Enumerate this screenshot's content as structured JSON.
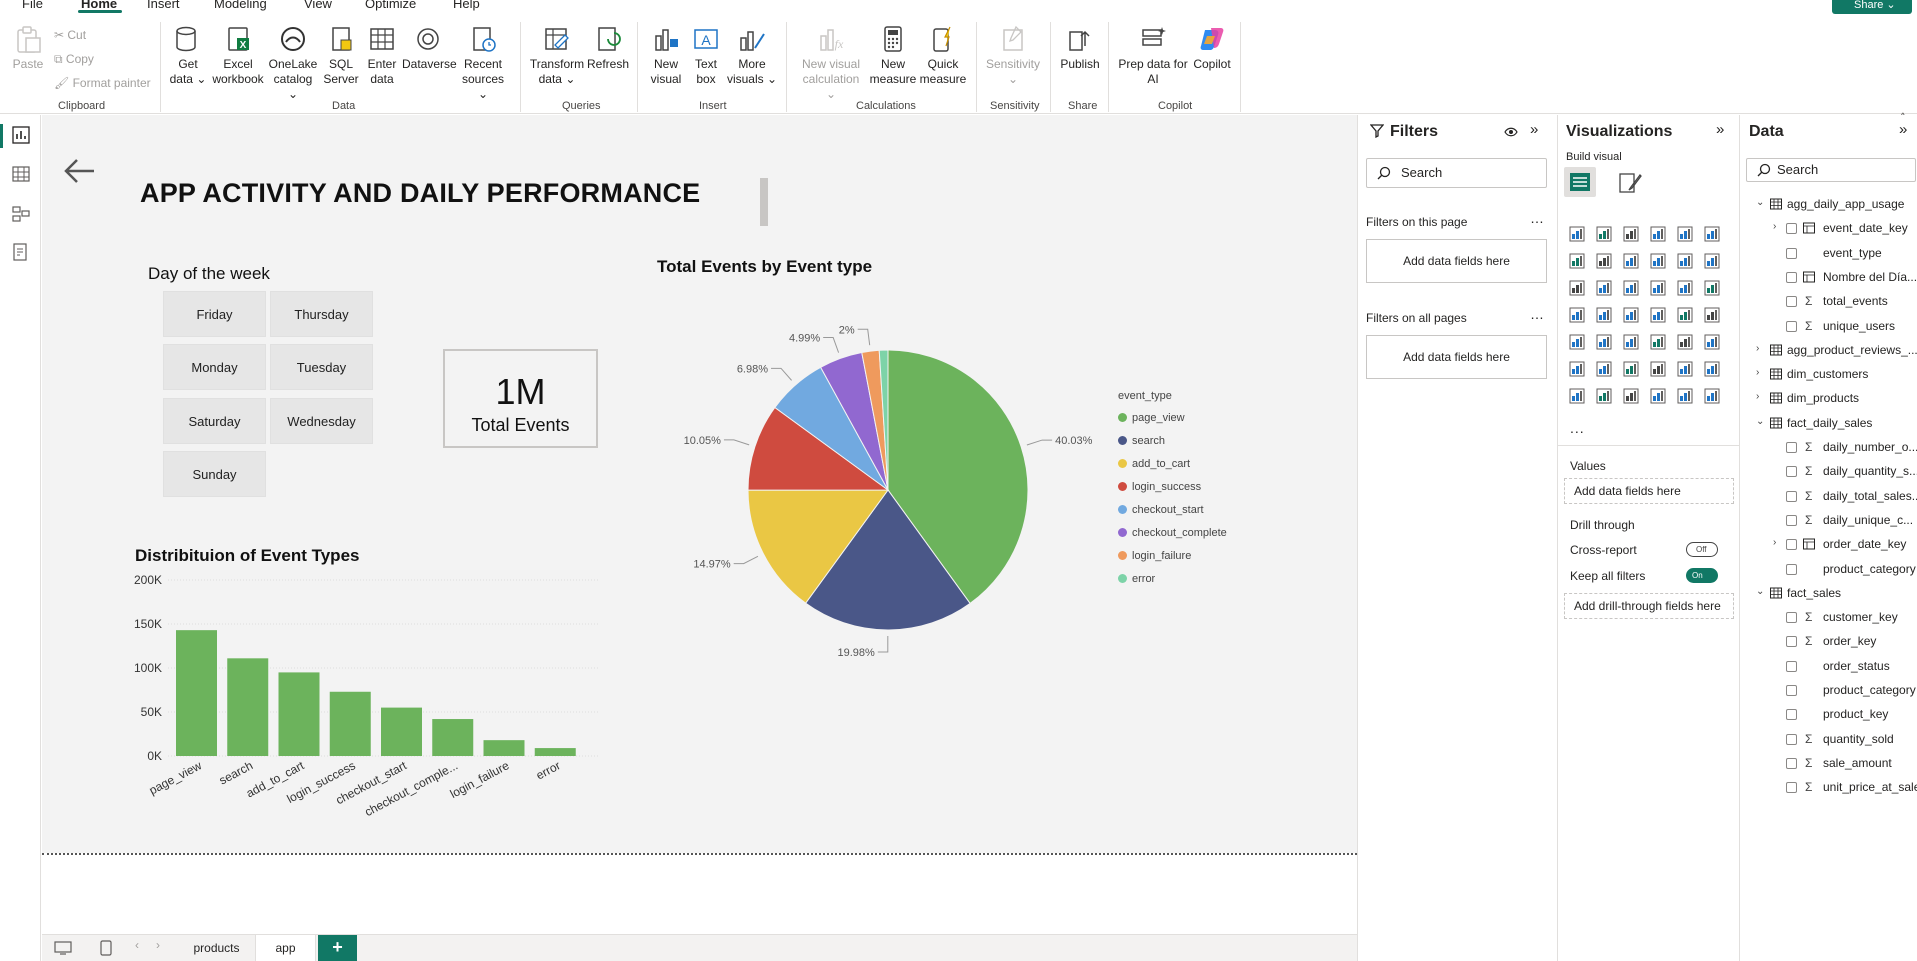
{
  "menu": {
    "items": [
      "File",
      "Home",
      "Insert",
      "Modeling",
      "View",
      "Optimize",
      "Help"
    ],
    "active": "Home",
    "share_label": "Share"
  },
  "ribbon": {
    "clipboard": {
      "paste": "Paste",
      "cut": "Cut",
      "copy": "Copy",
      "format_painter": "Format painter",
      "group": "Clipboard"
    },
    "data": {
      "get_data": [
        "Get",
        "data"
      ],
      "excel": [
        "Excel",
        "workbook"
      ],
      "onelake": [
        "OneLake",
        "catalog"
      ],
      "sql": [
        "SQL",
        "Server"
      ],
      "enter": [
        "Enter",
        "data"
      ],
      "dataverse": [
        "Dataverse"
      ],
      "recent": [
        "Recent",
        "sources"
      ],
      "group": "Data"
    },
    "queries": {
      "transform": [
        "Transform",
        "data"
      ],
      "refresh": [
        "Refresh"
      ],
      "group": "Queries"
    },
    "insert": {
      "new_visual": [
        "New",
        "visual"
      ],
      "text_box": [
        "Text",
        "box"
      ],
      "more_visuals": [
        "More",
        "visuals"
      ],
      "group": "Insert"
    },
    "calculations": {
      "new_visual_calc": [
        "New visual",
        "calculation"
      ],
      "new_measure": [
        "New",
        "measure"
      ],
      "quick_measure": [
        "Quick",
        "measure"
      ],
      "group": "Calculations"
    },
    "sensitivity": {
      "label": "Sensitivity",
      "group": "Sensitivity"
    },
    "share": {
      "publish": "Publish",
      "group": "Share"
    },
    "copilot": {
      "prep": [
        "Prep data for",
        "AI"
      ],
      "copilot": "Copilot",
      "group": "Copilot"
    }
  },
  "report": {
    "title": "APP ACTIVITY AND DAILY PERFORMANCE",
    "slicer": {
      "title": "Day of the week",
      "days": [
        "Friday",
        "Thursday",
        "Monday",
        "Tuesday",
        "Saturday",
        "Wednesday",
        "Sunday"
      ]
    },
    "kpi": {
      "value": "1M",
      "label": "Total Events"
    },
    "bar_title": "Distribituion of Event Types",
    "pie_title": "Total Events by Event type"
  },
  "chart_data": [
    {
      "type": "bar",
      "title": "Distribituion of Event Types",
      "categories": [
        "page_view",
        "search",
        "add_to_cart",
        "login_success",
        "checkout_start",
        "checkout_comple...",
        "login_failure",
        "error"
      ],
      "values": [
        143000,
        111000,
        95000,
        73000,
        55000,
        42000,
        18000,
        9000
      ],
      "yticks": [
        "0K",
        "50K",
        "100K",
        "150K",
        "200K"
      ],
      "ylim": [
        0,
        200000
      ],
      "color": "#6cb35c",
      "grid": true
    },
    {
      "type": "pie",
      "title": "Total Events by Event type",
      "legend_title": "event_type",
      "legend_position": "right",
      "slices": [
        {
          "name": "page_view",
          "value": 40.03,
          "label": "40.03%",
          "color": "#6cb35c"
        },
        {
          "name": "search",
          "value": 19.98,
          "label": "19.98%",
          "color": "#4a5788"
        },
        {
          "name": "add_to_cart",
          "value": 14.97,
          "label": "14.97%",
          "color": "#eac744"
        },
        {
          "name": "login_success",
          "value": 10.05,
          "label": "10.05%",
          "color": "#cf4b3f"
        },
        {
          "name": "checkout_start",
          "value": 6.98,
          "label": "6.98%",
          "color": "#71a9e0"
        },
        {
          "name": "checkout_complete",
          "value": 4.99,
          "label": "4.99%",
          "color": "#9168d0"
        },
        {
          "name": "login_failure",
          "value": 2.0,
          "label": "2%",
          "color": "#ef9a5d"
        },
        {
          "name": "error",
          "value": 1.0,
          "label": "",
          "color": "#7dd3a8"
        }
      ]
    }
  ],
  "pages": {
    "tabs": [
      "products",
      "app"
    ],
    "active": "app",
    "add": "+"
  },
  "filters": {
    "title": "Filters",
    "search_placeholder": "Search",
    "on_this_page": "Filters on this page",
    "on_all_pages": "Filters on all pages",
    "add_fields": "Add data fields here"
  },
  "visualizations": {
    "title": "Visualizations",
    "build_visual": "Build visual",
    "values": "Values",
    "add_fields": "Add data fields here",
    "drill_through": "Drill through",
    "cross_report": "Cross-report",
    "cross_report_state": "Off",
    "keep_filters": "Keep all filters",
    "keep_filters_state": "On",
    "add_drill": "Add drill-through fields here",
    "more": "..."
  },
  "data_pane": {
    "title": "Data",
    "search_placeholder": "Search",
    "tree": [
      {
        "label": "agg_daily_app_usage",
        "level": 0,
        "expanded": true,
        "kind": "table"
      },
      {
        "label": "event_date_key",
        "level": 1,
        "kind": "hierarchy",
        "collapsed": true
      },
      {
        "label": "event_type",
        "level": 1,
        "kind": "field"
      },
      {
        "label": "Nombre del Día...",
        "level": 1,
        "kind": "calc"
      },
      {
        "label": "total_events",
        "level": 1,
        "kind": "sum"
      },
      {
        "label": "unique_users",
        "level": 1,
        "kind": "sum"
      },
      {
        "label": "agg_product_reviews_...",
        "level": 0,
        "expanded": false,
        "kind": "table"
      },
      {
        "label": "dim_customers",
        "level": 0,
        "expanded": false,
        "kind": "table"
      },
      {
        "label": "dim_products",
        "level": 0,
        "expanded": false,
        "kind": "table"
      },
      {
        "label": "fact_daily_sales",
        "level": 0,
        "expanded": true,
        "kind": "table"
      },
      {
        "label": "daily_number_o...",
        "level": 1,
        "kind": "sum"
      },
      {
        "label": "daily_quantity_s...",
        "level": 1,
        "kind": "sum"
      },
      {
        "label": "daily_total_sales...",
        "level": 1,
        "kind": "sum"
      },
      {
        "label": "daily_unique_c...",
        "level": 1,
        "kind": "sum"
      },
      {
        "label": "order_date_key",
        "level": 1,
        "kind": "hierarchy",
        "collapsed": true
      },
      {
        "label": "product_category",
        "level": 1,
        "kind": "field"
      },
      {
        "label": "fact_sales",
        "level": 0,
        "expanded": true,
        "kind": "table"
      },
      {
        "label": "customer_key",
        "level": 1,
        "kind": "sum"
      },
      {
        "label": "order_key",
        "level": 1,
        "kind": "sum"
      },
      {
        "label": "order_status",
        "level": 1,
        "kind": "field"
      },
      {
        "label": "product_category",
        "level": 1,
        "kind": "field"
      },
      {
        "label": "product_key",
        "level": 1,
        "kind": "field"
      },
      {
        "label": "quantity_sold",
        "level": 1,
        "kind": "sum"
      },
      {
        "label": "sale_amount",
        "level": 1,
        "kind": "sum"
      },
      {
        "label": "unit_price_at_sale",
        "level": 1,
        "kind": "sum"
      }
    ]
  }
}
